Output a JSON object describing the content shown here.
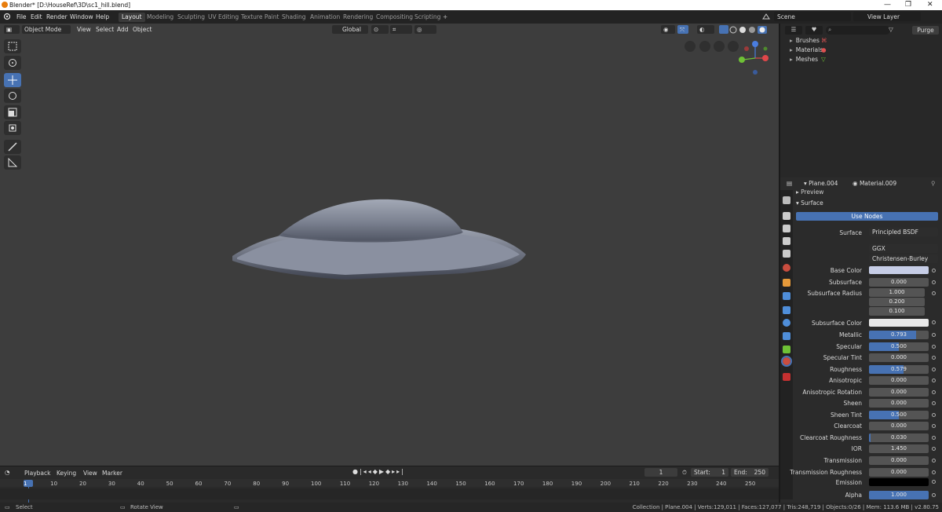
{
  "window": {
    "title": "Blender* [D:\\HouseRef\\3D\\sc1_hill.blend]",
    "controls": [
      "—",
      "❐",
      "✕"
    ]
  },
  "menu": [
    "File",
    "Edit",
    "Render",
    "Window",
    "Help"
  ],
  "workspaces": [
    "Layout",
    "Modeling",
    "Sculpting",
    "UV Editing",
    "Texture Paint",
    "Shading",
    "Animation",
    "Rendering",
    "Compositing",
    "Scripting"
  ],
  "workspace_add": "+",
  "scene": {
    "label": "Scene",
    "view_layer": "View Layer"
  },
  "viewport_header": {
    "mode": "Object Mode",
    "items": [
      "View",
      "Select",
      "Add",
      "Object"
    ],
    "transform_orientation": "Global"
  },
  "outliner": {
    "search_placeholder": "",
    "purge": "Purge",
    "items": [
      {
        "label": "Brushes"
      },
      {
        "label": "Materials"
      },
      {
        "label": "Meshes"
      }
    ]
  },
  "properties": {
    "object": "Plane.004",
    "material": "Material.009",
    "preview": "Preview",
    "surface_panel": "Surface",
    "use_nodes": "Use Nodes",
    "surface_label": "Surface",
    "surface_value": "Principled BSDF",
    "distribution": "GGX",
    "subsurface_method": "Christensen-Burley",
    "base_color_label": "Base Color",
    "subsurface_radius_label": "Subsurface Radius",
    "subsurface_radius": [
      "1.000",
      "0.200",
      "0.100"
    ],
    "subsurface_color_label": "Subsurface Color",
    "emission_label": "Emission",
    "colors": {
      "base": "#c6cde6",
      "subsurface": "#e8e8e8",
      "emission": "#000000"
    },
    "params": [
      {
        "label": "Subsurface",
        "value": "0.000",
        "fraction": 0
      },
      {
        "label": "Metallic",
        "value": "0.793",
        "fraction": 0.793
      },
      {
        "label": "Specular",
        "value": "0.500",
        "fraction": 0.5
      },
      {
        "label": "Specular Tint",
        "value": "0.000",
        "fraction": 0
      },
      {
        "label": "Roughness",
        "value": "0.579",
        "fraction": 0.579
      },
      {
        "label": "Anisotropic",
        "value": "0.000",
        "fraction": 0
      },
      {
        "label": "Anisotropic Rotation",
        "value": "0.000",
        "fraction": 0
      },
      {
        "label": "Sheen",
        "value": "0.000",
        "fraction": 0
      },
      {
        "label": "Sheen Tint",
        "value": "0.500",
        "fraction": 0.5
      },
      {
        "label": "Clearcoat",
        "value": "0.000",
        "fraction": 0
      },
      {
        "label": "Clearcoat Roughness",
        "value": "0.030",
        "fraction": 0.03
      },
      {
        "label": "IOR",
        "value": "1.450",
        "fraction": 0
      },
      {
        "label": "Transmission",
        "value": "0.000",
        "fraction": 0
      },
      {
        "label": "Transmission Roughness",
        "value": "0.000",
        "fraction": 0
      },
      {
        "label": "Alpha",
        "value": "1.000",
        "fraction": 1
      }
    ]
  },
  "timeline": {
    "menus": [
      "Playback",
      "Keying",
      "View",
      "Marker"
    ],
    "current_frame": "1",
    "start_label": "Start:",
    "start": "1",
    "end_label": "End:",
    "end": "250",
    "ticks": [
      "1",
      "10",
      "20",
      "30",
      "40",
      "50",
      "60",
      "70",
      "80",
      "90",
      "100",
      "110",
      "120",
      "130",
      "140",
      "150",
      "160",
      "170",
      "180",
      "190",
      "200",
      "210",
      "220",
      "230",
      "240",
      "250"
    ]
  },
  "status": {
    "left": "Select",
    "middle": "Rotate View",
    "right": "Collection | Plane.004 | Verts:129,011 | Faces:127,077 | Tris:248,719 | Objects:0/26 | Mem: 113.6 MB | v2.80.75"
  },
  "accent": "#4772b3"
}
